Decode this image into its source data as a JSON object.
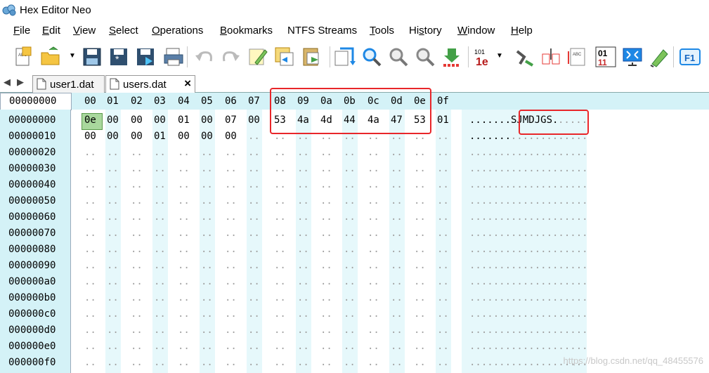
{
  "app": {
    "title": "Hex Editor Neo"
  },
  "menu": [
    {
      "pre": "",
      "mn": "F",
      "post": "ile"
    },
    {
      "pre": "",
      "mn": "E",
      "post": "dit"
    },
    {
      "pre": "",
      "mn": "V",
      "post": "iew"
    },
    {
      "pre": "",
      "mn": "S",
      "post": "elect"
    },
    {
      "pre": "",
      "mn": "O",
      "post": "perations"
    },
    {
      "pre": "",
      "mn": "B",
      "post": "ookmarks"
    },
    {
      "pre": "NTFS Streams",
      "mn": "",
      "post": ""
    },
    {
      "pre": "",
      "mn": "T",
      "post": "ools"
    },
    {
      "pre": "Hi",
      "mn": "s",
      "post": "tory"
    },
    {
      "pre": "",
      "mn": "W",
      "post": "indow"
    },
    {
      "pre": "",
      "mn": "H",
      "post": "elp"
    }
  ],
  "toolbar_icons": [
    "new-file-icon",
    "open-file-icon",
    "save-icon",
    "save-all-icon",
    "save-as-icon",
    "print-icon",
    "undo-icon",
    "redo-icon",
    "edit-icon",
    "copy-hex-icon",
    "paste-icon",
    "go-to-icon",
    "find-icon",
    "find-next-icon",
    "find-previous-icon",
    "fill-icon",
    "data-inspector-icon",
    "encoding-icon",
    "compare-icon",
    "structure-icon",
    "bits-icon",
    "fullscreen-icon",
    "highlight-icon",
    "help-icon"
  ],
  "tabs": [
    {
      "label": "user1.dat",
      "active": false
    },
    {
      "label": "users.dat",
      "active": true,
      "close": "×"
    }
  ],
  "editor": {
    "header_address": "00000000",
    "column_headers": [
      "00",
      "01",
      "02",
      "03",
      "04",
      "05",
      "06",
      "07",
      "08",
      "09",
      "0a",
      "0b",
      "0c",
      "0d",
      "0e",
      "0f"
    ],
    "rows": [
      {
        "address": "00000000",
        "bytes": [
          "0e",
          "00",
          "00",
          "00",
          "01",
          "00",
          "07",
          "00",
          "53",
          "4a",
          "4d",
          "44",
          "4a",
          "47",
          "53",
          "01"
        ],
        "text": ".......SJMDJGS."
      },
      {
        "address": "00000010",
        "bytes": [
          "00",
          "00",
          "00",
          "01",
          "00",
          "00",
          "00"
        ],
        "text": "......."
      },
      {
        "address": "00000020",
        "bytes": [],
        "text": ""
      },
      {
        "address": "00000030",
        "bytes": [],
        "text": ""
      },
      {
        "address": "00000040",
        "bytes": [],
        "text": ""
      },
      {
        "address": "00000050",
        "bytes": [],
        "text": ""
      },
      {
        "address": "00000060",
        "bytes": [],
        "text": ""
      },
      {
        "address": "00000070",
        "bytes": [],
        "text": ""
      },
      {
        "address": "00000080",
        "bytes": [],
        "text": ""
      },
      {
        "address": "00000090",
        "bytes": [],
        "text": ""
      },
      {
        "address": "000000a0",
        "bytes": [],
        "text": ""
      },
      {
        "address": "000000b0",
        "bytes": [],
        "text": ""
      },
      {
        "address": "000000c0",
        "bytes": [],
        "text": ""
      },
      {
        "address": "000000d0",
        "bytes": [],
        "text": ""
      },
      {
        "address": "000000e0",
        "bytes": [],
        "text": ""
      },
      {
        "address": "000000f0",
        "bytes": [],
        "text": ""
      }
    ],
    "empty_byte": "..",
    "selected_byte": "0e"
  },
  "watermark": "https://blog.csdn.net/qq_48455576",
  "colors": {
    "highlight_box": "#e8262a",
    "header_band": "#d4f2f7",
    "cursor": "#a9d89d"
  }
}
